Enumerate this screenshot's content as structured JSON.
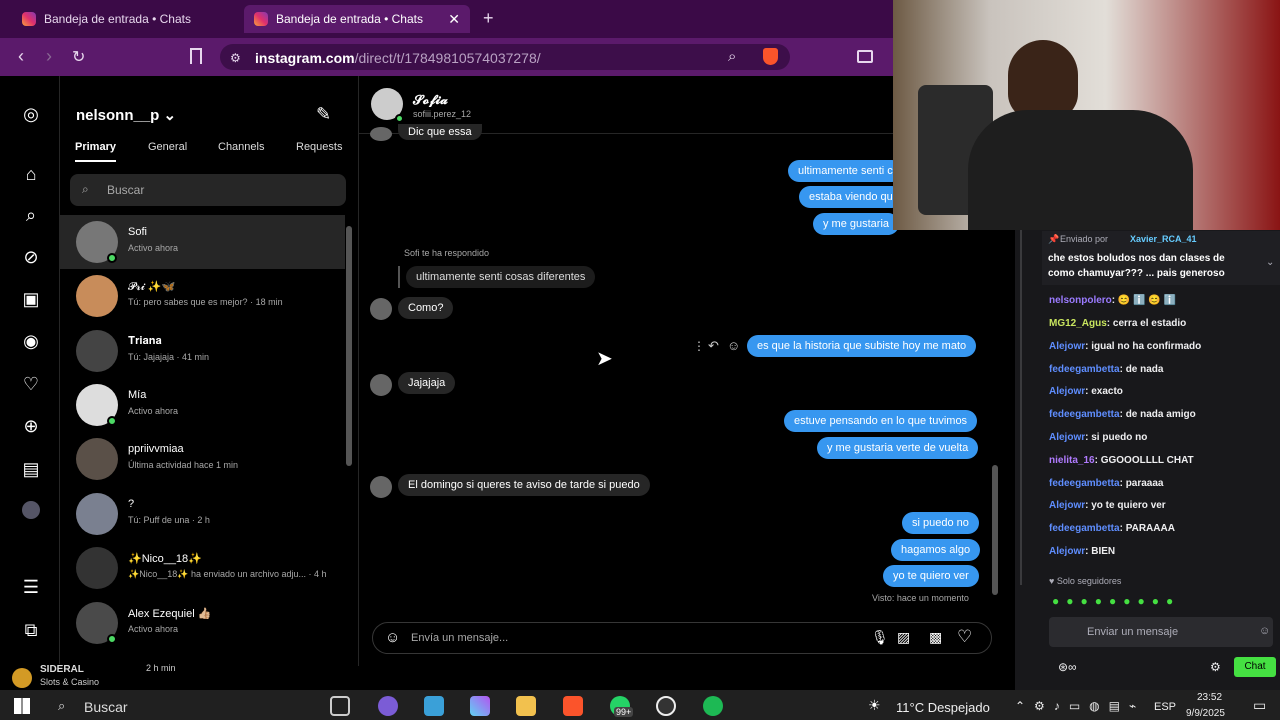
{
  "browser": {
    "tab1_title": "Bandeja de entrada • Chats",
    "tab2_title": "Bandeja de entrada • Chats",
    "url_host": "instagram.com",
    "url_path": "/direct/t/17849810574037278/"
  },
  "ig": {
    "username": "nelsonn__p",
    "tabs": [
      "Primary",
      "General",
      "Channels",
      "Requests"
    ],
    "search_placeholder": "Buscar",
    "conversations": [
      {
        "name": "Sofi",
        "sub": "Activo ahora"
      },
      {
        "name": "𝓟𝓻𝓲 ✨🦋",
        "sub": "Tú: pero sabes que es mejor? · 18 min"
      },
      {
        "name": "𝐓𝐫𝐢𝐚𝐧𝐚",
        "sub": "Tú: Jajajaja · 41 min"
      },
      {
        "name": "Mía",
        "sub": "Activo ahora"
      },
      {
        "name": "ppriivvmiaa",
        "sub": "Última actividad hace 1 min"
      },
      {
        "name": "?",
        "sub": "Tú: Puff de una · 2 h"
      },
      {
        "name": "✨Nico__18✨",
        "sub": "✨Nico__18✨ ha enviado un archivo adju... · 4 h"
      },
      {
        "name": "Alex Ezequiel 👍🏼",
        "sub": "Activo ahora"
      }
    ],
    "chat": {
      "contact_name": "𝓢𝓸𝓯𝓲𝓪",
      "contact_handle": "sofiii.perez_12",
      "partial_top": "Dic que essa",
      "out1": "ultimamente senti c",
      "out2": "estaba viendo qu",
      "out3": "y me gustaria",
      "reply_label": "Sofi te ha respondido",
      "reply_quote": "ultimamente senti cosas diferentes",
      "in1": "Como?",
      "out4": "es que la historia que subiste hoy me mato",
      "in2": "Jajajaja",
      "out5": "estuve pensando en lo que tuvimos",
      "out6": "y me gustaria verte de vuelta",
      "in3": "El domingo si queres te aviso de tarde si puedo",
      "out7": "si puedo no",
      "out8": "hagamos algo",
      "out9": "yo te quiero ver",
      "seen": "Visto: hace un momento",
      "composer_placeholder": "Envía un mensaje..."
    }
  },
  "stream": {
    "pinned_by": "Enviado por",
    "pinned_user": "Xavier_RCA_41",
    "pinned_text": "che estos boludos nos dan clases de como chamuyar??? ... pais generoso",
    "messages": [
      {
        "user": "nelsonpolero",
        "text": "😊 ℹ️ 😊 ℹ️",
        "color": "#9b7bff"
      },
      {
        "user": "MG12_Agus",
        "text": "cerra el estadio",
        "color": "#c9e65f"
      },
      {
        "user": "Alejowr",
        "text": "igual no ha confirmado",
        "color": "#5f8eff"
      },
      {
        "user": "fedeegambetta",
        "text": "de nada",
        "color": "#5f8eff"
      },
      {
        "user": "Alejowr",
        "text": "exacto",
        "color": "#5f8eff"
      },
      {
        "user": "fedeegambetta",
        "text": "de nada amigo",
        "color": "#5f8eff"
      },
      {
        "user": "Alejowr",
        "text": "si puedo no",
        "color": "#5f8eff"
      },
      {
        "user": "nielita_16",
        "text": "GGOOOLLLL CHAT",
        "color": "#b07bff"
      },
      {
        "user": "fedeegambetta",
        "text": "paraaaa",
        "color": "#5f8eff"
      },
      {
        "user": "Alejowr",
        "text": "yo te quiero ver",
        "color": "#5f8eff"
      },
      {
        "user": "fedeegambetta",
        "text": "PARAAAA",
        "color": "#5f8eff"
      },
      {
        "user": "Alejowr",
        "text": "BIEN",
        "color": "#5f8eff"
      }
    ],
    "followers_only": "Solo seguidores",
    "send_placeholder": "Enviar un mensaje",
    "chat_button": "Chat"
  },
  "overlay": {
    "sponsor": "SIDERAL",
    "sponsor_sub": "Slots & Casino",
    "time_ago": "2 h min"
  },
  "taskbar": {
    "search": "Buscar",
    "weather": "11°C  Despejado",
    "lang": "ESP",
    "time": "23:52",
    "date": "9/9/2025",
    "badge": "99+"
  }
}
